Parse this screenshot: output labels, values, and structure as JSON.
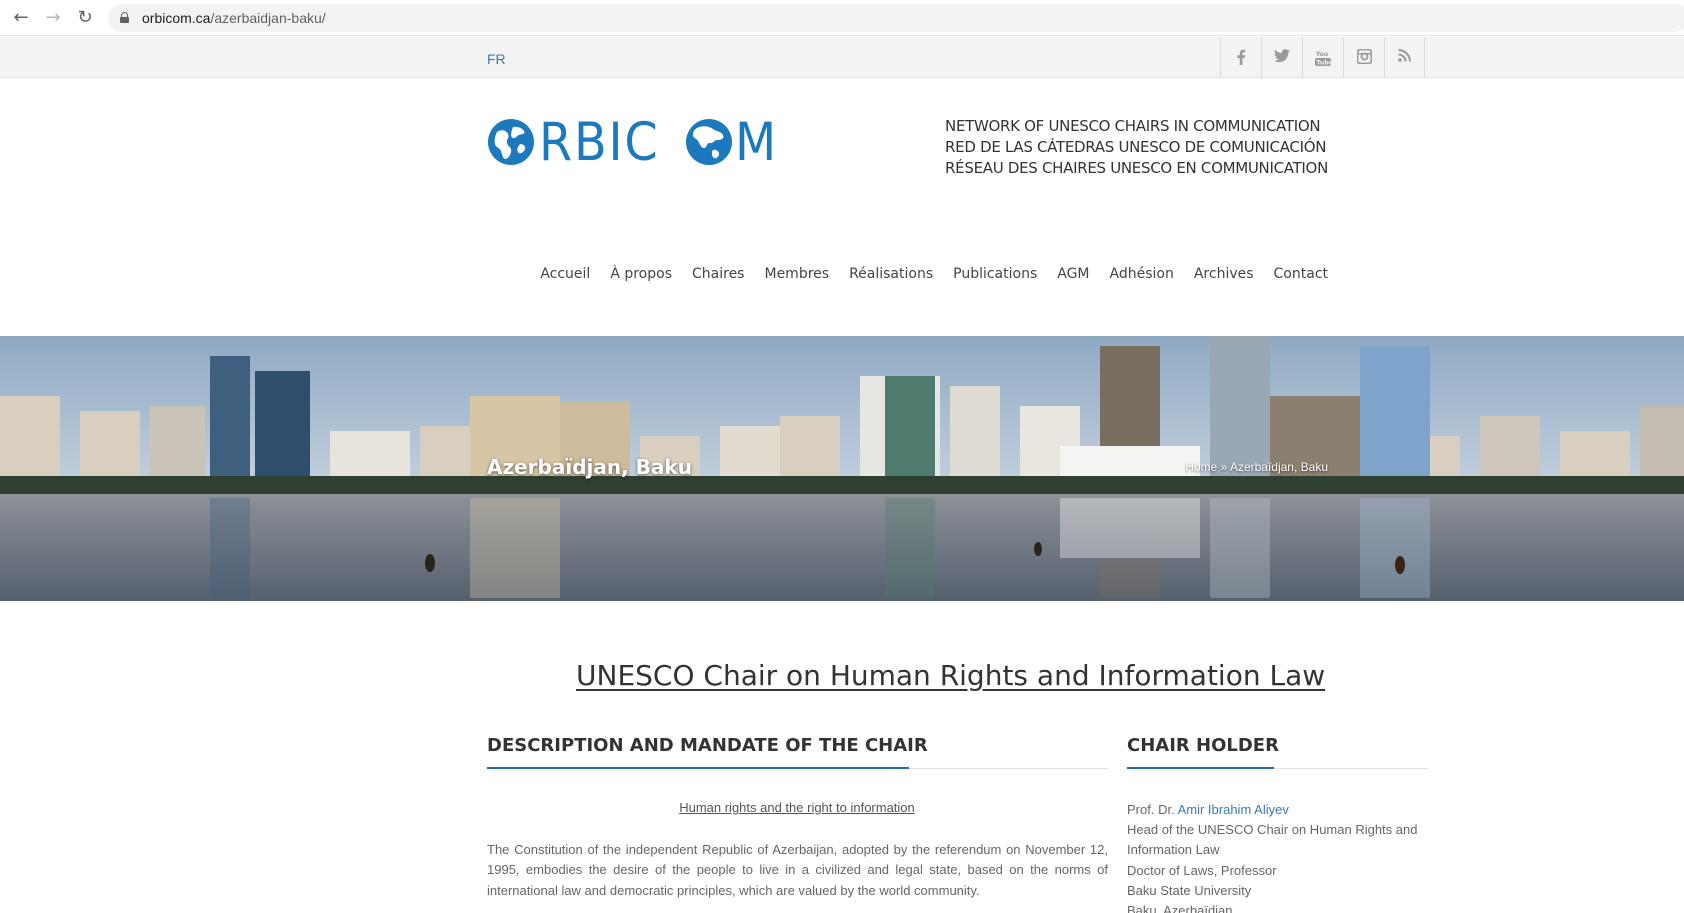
{
  "browser": {
    "url_domain": "orbicom.ca",
    "url_path": "/azerbaidjan-baku/"
  },
  "topbar": {
    "lang": "FR",
    "social_icons": [
      "facebook-icon",
      "twitter-icon",
      "youtube-icon",
      "instagram-icon",
      "rss-icon"
    ]
  },
  "header": {
    "logo_text": "RBIC  M",
    "tagline": [
      "NETWORK OF UNESCO CHAIRS IN COMMUNICATION",
      "RED DE LAS CÁTEDRAS UNESCO DE COMUNICACIÓN",
      "RÉSEAU DES CHAIRES UNESCO EN COMMUNICATION"
    ],
    "brand_color": "#1c79bd"
  },
  "nav": {
    "items": [
      "Accueil",
      "À propos",
      "Chaires",
      "Membres",
      "Réalisations",
      "Publications",
      "AGM",
      "Adhésion",
      "Archives",
      "Contact"
    ]
  },
  "banner": {
    "title": "Azerbaïdjan, Baku",
    "breadcrumb_home": "Home",
    "breadcrumb_sep": "»",
    "breadcrumb_current": "Azerbaïdjan, Baku"
  },
  "content": {
    "heading": "UNESCO Chair on Human Rights and Information Law",
    "left": {
      "section_title": "DESCRIPTION AND MANDATE OF THE CHAIR",
      "subhead": "Human rights and the right to information",
      "paragraph": "The Constitution of the independent Republic of Azerbaijan, adopted by the referendum on November 12, 1995, embodies the desire of the people to live in a civilized and legal state, based on the norms of international law and democratic principles, which are valued by the world community."
    },
    "right": {
      "section_title": "CHAIR HOLDER",
      "prefix": "Prof. Dr.",
      "holder_name": "Amir Ibrahim Aliyev",
      "lines": [
        "Head of the UNESCO Chair on Human Rights and Information Law",
        "Doctor of Laws, Professor",
        "Baku State University",
        "Baku, Azerbaïdjan"
      ]
    }
  }
}
